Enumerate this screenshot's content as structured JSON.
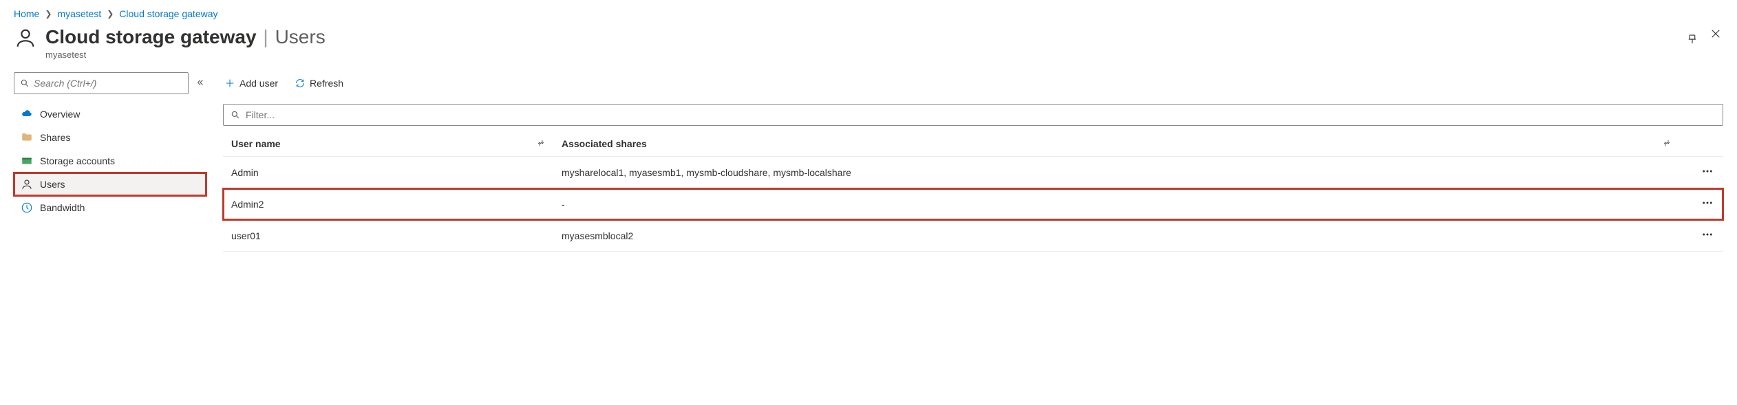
{
  "breadcrumb": {
    "items": [
      {
        "label": "Home"
      },
      {
        "label": "myasetest"
      },
      {
        "label": "Cloud storage gateway"
      }
    ]
  },
  "header": {
    "title": "Cloud storage gateway",
    "subtitle": "Users",
    "resource": "myasetest"
  },
  "sidebar": {
    "search_placeholder": "Search (Ctrl+/)",
    "items": [
      {
        "label": "Overview",
        "icon": "cloud",
        "active": false
      },
      {
        "label": "Shares",
        "icon": "folder",
        "active": false
      },
      {
        "label": "Storage accounts",
        "icon": "storage",
        "active": false
      },
      {
        "label": "Users",
        "icon": "user",
        "active": true,
        "highlighted": true
      },
      {
        "label": "Bandwidth",
        "icon": "bandwidth",
        "active": false
      }
    ]
  },
  "toolbar": {
    "add_user_label": "Add user",
    "refresh_label": "Refresh"
  },
  "filter": {
    "placeholder": "Filter..."
  },
  "table": {
    "columns": {
      "name": "User name",
      "shares": "Associated shares"
    },
    "rows": [
      {
        "name": "Admin",
        "shares": "mysharelocal1, myasesmb1, mysmb-cloudshare, mysmb-localshare",
        "highlighted": false
      },
      {
        "name": "Admin2",
        "shares": "-",
        "highlighted": true
      },
      {
        "name": "user01",
        "shares": "myasesmblocal2",
        "highlighted": false
      }
    ]
  }
}
